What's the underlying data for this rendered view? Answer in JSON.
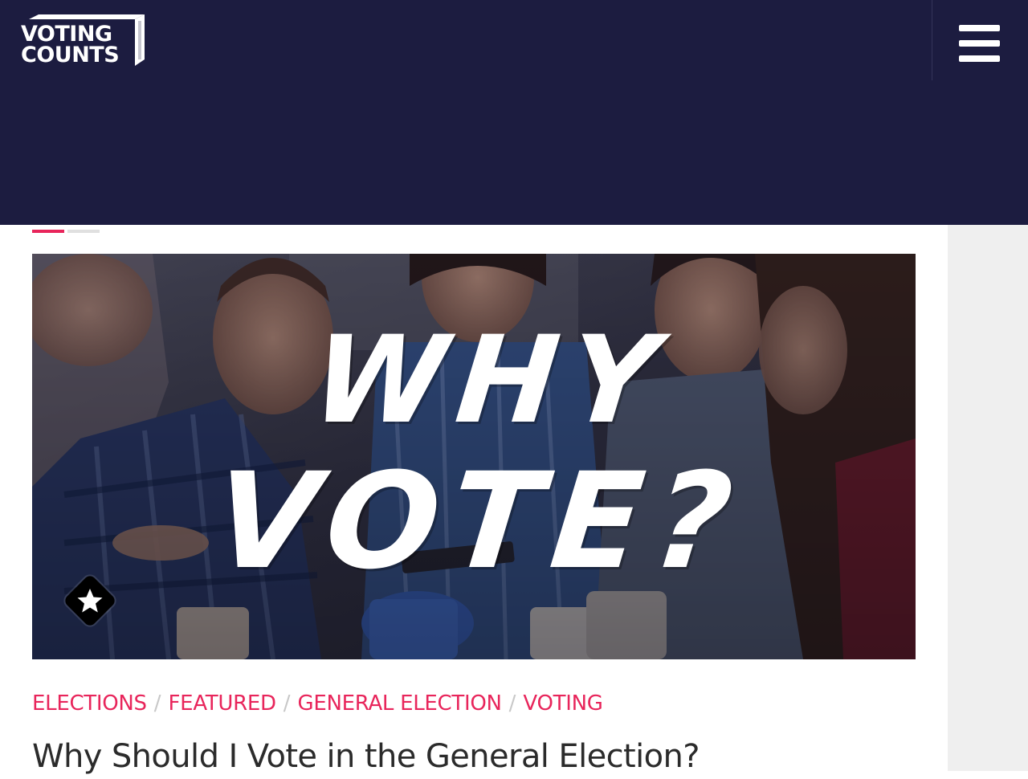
{
  "header": {
    "logo": {
      "line1": "VOTING",
      "line2": "COUNTS"
    },
    "menu_icon": "hamburger-menu-icon"
  },
  "slider": {
    "slide_count": 2,
    "active_index": 0
  },
  "hero": {
    "image_text_line1": "WHY",
    "image_text_line2": "VOTE?",
    "badge_icon": "star-icon"
  },
  "post": {
    "categories": [
      "ELECTIONS",
      "FEATURED",
      "GENERAL ELECTION",
      "VOTING"
    ],
    "separator": "/",
    "title": "Why Should I Vote in the General Election?"
  },
  "colors": {
    "header_bg": "#1c1c40",
    "accent": "#e8255b",
    "sidebar_bg": "#efefef",
    "title_text": "#2b2b2b"
  }
}
